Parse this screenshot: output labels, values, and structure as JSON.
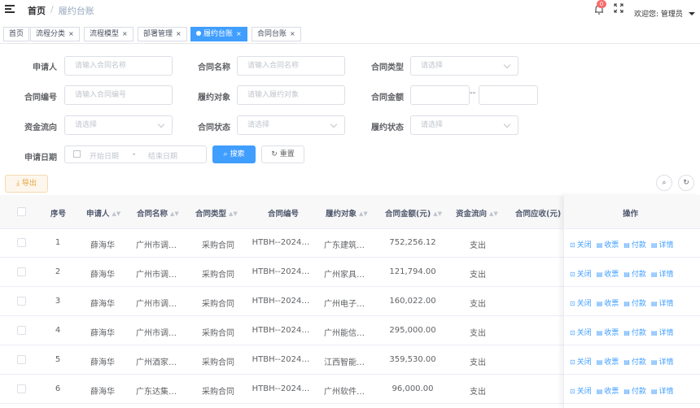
{
  "header": {
    "breadcrumb_home": "首页",
    "breadcrumb_sep": "/",
    "breadcrumb_current": "履约台账",
    "notification_count": "0",
    "welcome": "欢迎您: 管理员"
  },
  "tabs": [
    {
      "label": "首页",
      "closable": false,
      "active": false
    },
    {
      "label": "流程分类",
      "closable": true,
      "active": false
    },
    {
      "label": "流程模型",
      "closable": true,
      "active": false
    },
    {
      "label": "部署管理",
      "closable": true,
      "active": false
    },
    {
      "label": "履约台账",
      "closable": true,
      "active": true
    },
    {
      "label": "合同台账",
      "closable": true,
      "active": false
    }
  ],
  "tab_close": "×",
  "form": {
    "applicant_label": "申请人",
    "applicant_placeholder": "请输入合同名称",
    "contract_name_label": "合同名称",
    "contract_name_placeholder": "请输入合同名称",
    "contract_type_label": "合同类型",
    "contract_type_placeholder": "请选择",
    "contract_no_label": "合同编号",
    "contract_no_placeholder": "请输入合同编号",
    "perform_obj_label": "履约对象",
    "perform_obj_placeholder": "请输入履约对象",
    "amount_label": "合同金额",
    "amount_sep": "--",
    "fund_flow_label": "资金流向",
    "fund_flow_placeholder": "请选择",
    "contract_status_label": "合同状态",
    "contract_status_placeholder": "请选择",
    "perform_status_label": "履约状态",
    "perform_status_placeholder": "请选择",
    "apply_date_label": "申请日期",
    "start_placeholder": "开始日期",
    "range_sep": "-",
    "end_placeholder": "结束日期",
    "search_label": "搜索",
    "reset_label": "重置"
  },
  "toolbar": {
    "export_label": "导出"
  },
  "table": {
    "headers": {
      "index": "序号",
      "applicant": "申请人",
      "contract_name": "合同名称",
      "contract_type": "合同类型",
      "contract_no": "合同编号",
      "perform_obj": "履约对象",
      "amount": "合同金额(元)",
      "fund_flow": "资金流向",
      "receivable": "合同应收(元)",
      "actions": "操作"
    },
    "rows": [
      {
        "index": "1",
        "applicant": "薛海华",
        "contract_name": "广州市调…",
        "contract_type": "采购合同",
        "contract_no": "HTBH--2024…",
        "perform_obj": "广东建筑…",
        "amount": "752,256.12",
        "fund_flow": "支出"
      },
      {
        "index": "2",
        "applicant": "薛海华",
        "contract_name": "广州市调…",
        "contract_type": "采购合同",
        "contract_no": "HTBH--2024…",
        "perform_obj": "广州家具…",
        "amount": "121,794.00",
        "fund_flow": "支出"
      },
      {
        "index": "3",
        "applicant": "薛海华",
        "contract_name": "广州市调…",
        "contract_type": "采购合同",
        "contract_no": "HTBH--2024…",
        "perform_obj": "广州电子…",
        "amount": "160,022.00",
        "fund_flow": "支出"
      },
      {
        "index": "4",
        "applicant": "薛海华",
        "contract_name": "广州市调…",
        "contract_type": "采购合同",
        "contract_no": "HTBH--2024…",
        "perform_obj": "广州能信…",
        "amount": "295,000.00",
        "fund_flow": "支出"
      },
      {
        "index": "5",
        "applicant": "薛海华",
        "contract_name": "广州酒家…",
        "contract_type": "采购合同",
        "contract_no": "HTBH--2024…",
        "perform_obj": "江西智能…",
        "amount": "359,530.00",
        "fund_flow": "支出"
      },
      {
        "index": "6",
        "applicant": "薛海华",
        "contract_name": "广东达集…",
        "contract_type": "采购合同",
        "contract_no": "HTBH--2024…",
        "perform_obj": "广州软件…",
        "amount": "96,000.00",
        "fund_flow": "支出"
      }
    ],
    "actions": [
      "关闭",
      "收票",
      "付款",
      "详情"
    ]
  },
  "colors": {
    "primary": "#409eff",
    "warning": "#e6a23c",
    "danger": "#f56c6c"
  }
}
